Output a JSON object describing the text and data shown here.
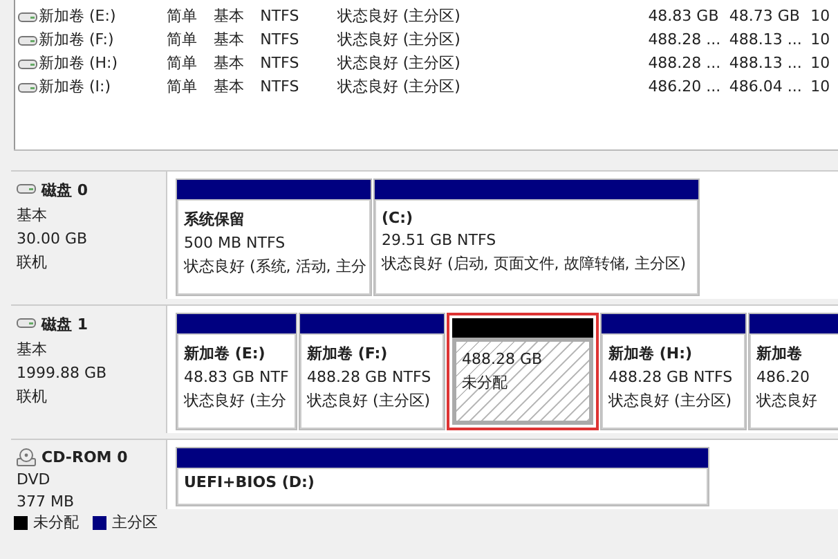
{
  "volume_list": {
    "rows": [
      {
        "name": "新加卷 (E:)",
        "layout": "简单",
        "type": "基本",
        "file_system": "NTFS",
        "status": "状态良好 (主分区)",
        "capacity": "48.83 GB",
        "free": "48.73 GB",
        "column_8": "10"
      },
      {
        "name": "新加卷 (F:)",
        "layout": "简单",
        "type": "基本",
        "file_system": "NTFS",
        "status": "状态良好 (主分区)",
        "capacity": "488.28 ...",
        "free": "488.13 ...",
        "column_8": "10"
      },
      {
        "name": "新加卷 (H:)",
        "layout": "简单",
        "type": "基本",
        "file_system": "NTFS",
        "status": "状态良好 (主分区)",
        "capacity": "488.28 ...",
        "free": "488.13 ...",
        "column_8": "10"
      },
      {
        "name": "新加卷 (I:)",
        "layout": "简单",
        "type": "基本",
        "file_system": "NTFS",
        "status": "状态良好 (主分区)",
        "capacity": "486.20 ...",
        "free": "486.04 ...",
        "column_8": "10"
      }
    ]
  },
  "disks": [
    {
      "kind": "disk",
      "name": "磁盘 0",
      "type": "基本",
      "size": "30.00 GB",
      "state": "联机",
      "partitions": [
        {
          "kind": "primary",
          "title": "系统保留",
          "size": "500 MB NTFS",
          "status": "状态良好 (系统, 活动, 主分",
          "highlighted": false
        },
        {
          "kind": "primary",
          "title": "(C:)",
          "size": "29.51 GB NTFS",
          "status": "状态良好 (启动, 页面文件, 故障转储, 主分区)",
          "highlighted": false
        }
      ]
    },
    {
      "kind": "disk",
      "name": "磁盘 1",
      "type": "基本",
      "size": "1999.88 GB",
      "state": "联机",
      "partitions": [
        {
          "kind": "primary",
          "title": "新加卷 (E:)",
          "size": "48.83 GB NTF",
          "status": "状态良好 (主分",
          "highlighted": false
        },
        {
          "kind": "primary",
          "title": "新加卷 (F:)",
          "size": "488.28 GB NTFS",
          "status": "状态良好 (主分区)",
          "highlighted": false
        },
        {
          "kind": "unallocated",
          "size": "488.28 GB",
          "status": "未分配",
          "highlighted": true
        },
        {
          "kind": "primary",
          "title": "新加卷 (H:)",
          "size": "488.28 GB NTFS",
          "status": "状态良好 (主分区)",
          "highlighted": false
        },
        {
          "kind": "primary",
          "title": "新加卷",
          "size": "486.20",
          "status": "状态良好",
          "highlighted": false
        }
      ]
    },
    {
      "kind": "cdrom",
      "name": "CD-ROM 0",
      "type": "DVD",
      "size": "377 MB",
      "partitions": [
        {
          "kind": "primary",
          "title": "UEFI+BIOS (D:)",
          "highlighted": false
        }
      ]
    }
  ],
  "legend": [
    {
      "kind": "unallocated",
      "label": "未分配"
    },
    {
      "kind": "primary",
      "label": "主分区"
    }
  ]
}
